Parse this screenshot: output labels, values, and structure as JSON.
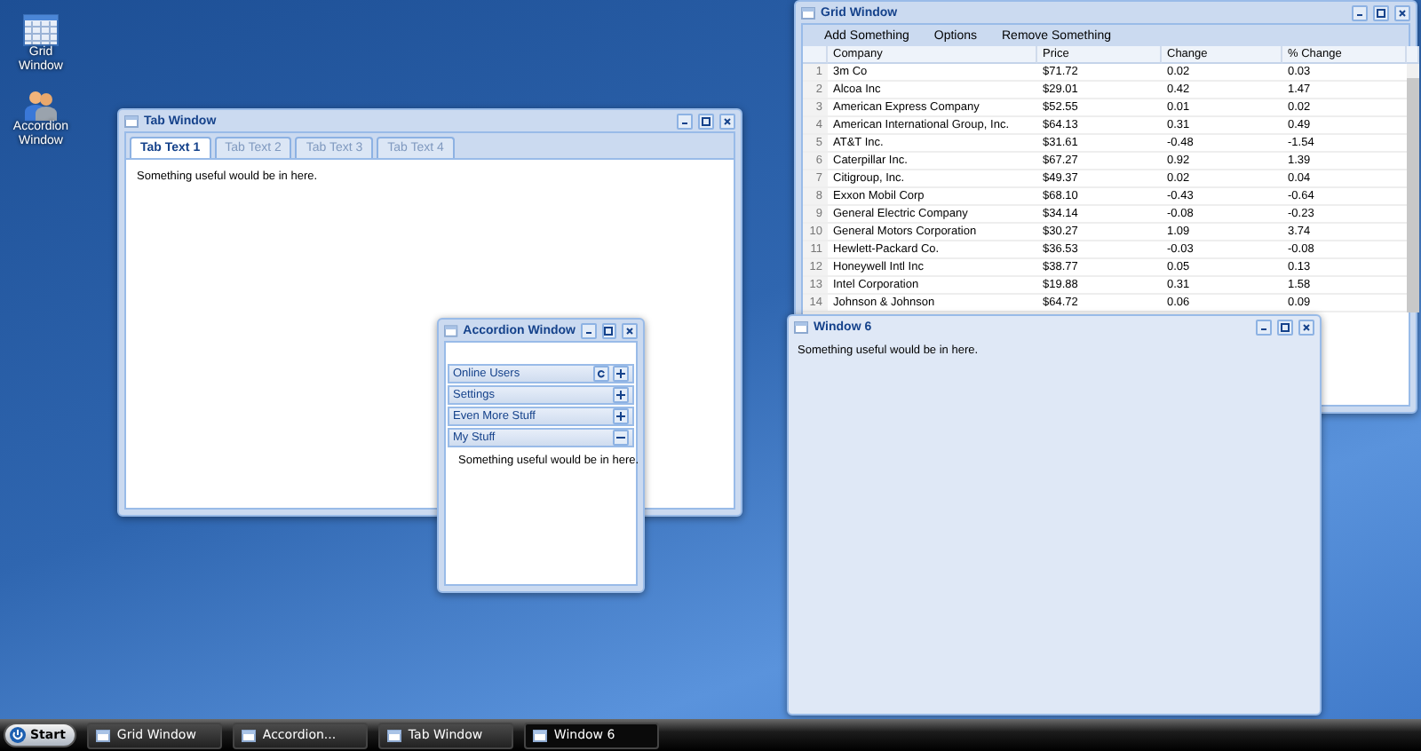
{
  "desktop_icons": [
    {
      "label": "Grid Window",
      "kind": "grid"
    },
    {
      "label": "Accordion Window",
      "kind": "people"
    }
  ],
  "windows": [
    {
      "kind": "tabs",
      "title": "Tab Window",
      "tabs": [
        {
          "label": "Tab Text 1",
          "selected": true
        },
        {
          "label": "Tab Text 2",
          "selected": false
        },
        {
          "label": "Tab Text 3",
          "selected": false
        },
        {
          "label": "Tab Text 4",
          "selected": false
        }
      ],
      "content": "Something useful would be in here."
    },
    {
      "kind": "accordion",
      "title": "Accordion Window",
      "panels": [
        {
          "label": "Online Users",
          "expanded": false,
          "refresh": true
        },
        {
          "label": "Settings",
          "expanded": false,
          "refresh": false
        },
        {
          "label": "Even More Stuff",
          "expanded": false,
          "refresh": false
        },
        {
          "label": "My Stuff",
          "expanded": true,
          "refresh": false
        }
      ],
      "content": "Something useful would be in here."
    },
    {
      "kind": "grid",
      "title": "Grid Window",
      "toolbar": [
        "Add Something",
        "Options",
        "Remove Something"
      ],
      "columns": [
        "",
        "Company",
        "Price",
        "Change",
        "% Change"
      ],
      "rows": [
        [
          "1",
          "3m Co",
          "$71.72",
          "0.02",
          "0.03"
        ],
        [
          "2",
          "Alcoa Inc",
          "$29.01",
          "0.42",
          "1.47"
        ],
        [
          "3",
          "American Express Company",
          "$52.55",
          "0.01",
          "0.02"
        ],
        [
          "4",
          "American International Group, Inc.",
          "$64.13",
          "0.31",
          "0.49"
        ],
        [
          "5",
          "AT&T Inc.",
          "$31.61",
          "-0.48",
          "-1.54"
        ],
        [
          "6",
          "Caterpillar Inc.",
          "$67.27",
          "0.92",
          "1.39"
        ],
        [
          "7",
          "Citigroup, Inc.",
          "$49.37",
          "0.02",
          "0.04"
        ],
        [
          "8",
          "Exxon Mobil Corp",
          "$68.10",
          "-0.43",
          "-0.64"
        ],
        [
          "9",
          "General Electric Company",
          "$34.14",
          "-0.08",
          "-0.23"
        ],
        [
          "10",
          "General Motors Corporation",
          "$30.27",
          "1.09",
          "3.74"
        ],
        [
          "11",
          "Hewlett-Packard Co.",
          "$36.53",
          "-0.03",
          "-0.08"
        ],
        [
          "12",
          "Honeywell Intl Inc",
          "$38.77",
          "0.05",
          "0.13"
        ],
        [
          "13",
          "Intel Corporation",
          "$19.88",
          "0.31",
          "1.58"
        ],
        [
          "14",
          "Johnson & Johnson",
          "$64.72",
          "0.06",
          "0.09"
        ]
      ]
    },
    {
      "kind": "plain",
      "title": "Window 6",
      "content": "Something useful would be in here."
    }
  ],
  "taskbar": {
    "start": "Start",
    "items": [
      {
        "label": "Grid Window",
        "selected": false
      },
      {
        "label": "Accordion...",
        "selected": false
      },
      {
        "label": "Tab Window",
        "selected": false
      },
      {
        "label": "Window 6",
        "selected": true
      }
    ]
  }
}
